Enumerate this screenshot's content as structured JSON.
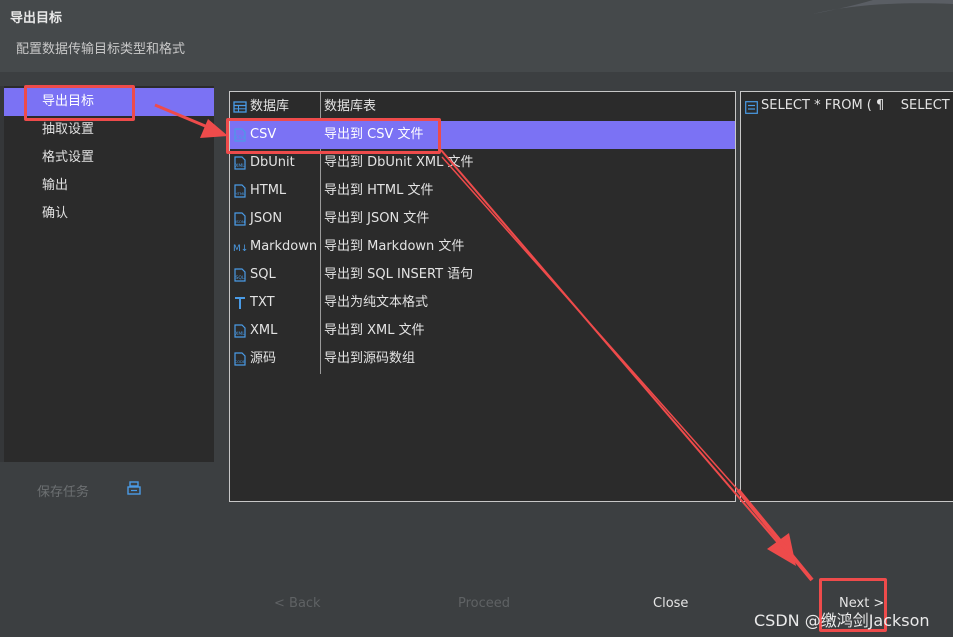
{
  "dialog": {
    "title": "导出目标",
    "subtitle": "配置数据传输目标类型和格式"
  },
  "nav": {
    "items": [
      {
        "label": "导出目标",
        "selected": true
      },
      {
        "label": "抽取设置",
        "selected": false
      },
      {
        "label": "格式设置",
        "selected": false
      },
      {
        "label": "输出",
        "selected": false
      },
      {
        "label": "确认",
        "selected": false
      }
    ]
  },
  "save_task": {
    "label": "保存任务",
    "icon": "save-task-icon"
  },
  "table": {
    "header": {
      "col1": "数据库",
      "col2": "数据库表",
      "icon": "table-icon"
    },
    "rows": [
      {
        "name": "CSV",
        "desc": "导出到 CSV 文件",
        "icon": "csv-file-icon",
        "selected": true
      },
      {
        "name": "DbUnit",
        "desc": "导出到 DbUnit XML 文件",
        "icon": "xml-file-icon",
        "selected": false
      },
      {
        "name": "HTML",
        "desc": "导出到 HTML 文件",
        "icon": "html-file-icon",
        "selected": false
      },
      {
        "name": "JSON",
        "desc": "导出到 JSON 文件",
        "icon": "json-file-icon",
        "selected": false
      },
      {
        "name": "Markdown",
        "desc": "导出到 Markdown 文件",
        "icon": "markdown-icon",
        "selected": false
      },
      {
        "name": "SQL",
        "desc": "导出到 SQL INSERT 语句",
        "icon": "sql-file-icon",
        "selected": false
      },
      {
        "name": "TXT",
        "desc": "导出为纯文本格式",
        "icon": "text-icon",
        "selected": false
      },
      {
        "name": "XML",
        "desc": "导出到 XML 文件",
        "icon": "xml-file-icon",
        "selected": false
      },
      {
        "name": "源码",
        "desc": "导出到源码数组",
        "icon": "code-file-icon",
        "selected": false
      }
    ]
  },
  "preview": {
    "text": "SELECT * FROM ( ¶    SELECT t.*",
    "icon": "query-icon"
  },
  "buttons": {
    "back": "< Back",
    "proceed": "Proceed",
    "close": "Close",
    "next": "Next >"
  },
  "watermark": "CSDN @缴鸿剑Jackson",
  "colors": {
    "selection": "#7b72f4",
    "annotation": "#ee4b4b",
    "background": "#3c3f41",
    "panel": "#2b2b2b",
    "icon_blue": "#4a9be6"
  }
}
